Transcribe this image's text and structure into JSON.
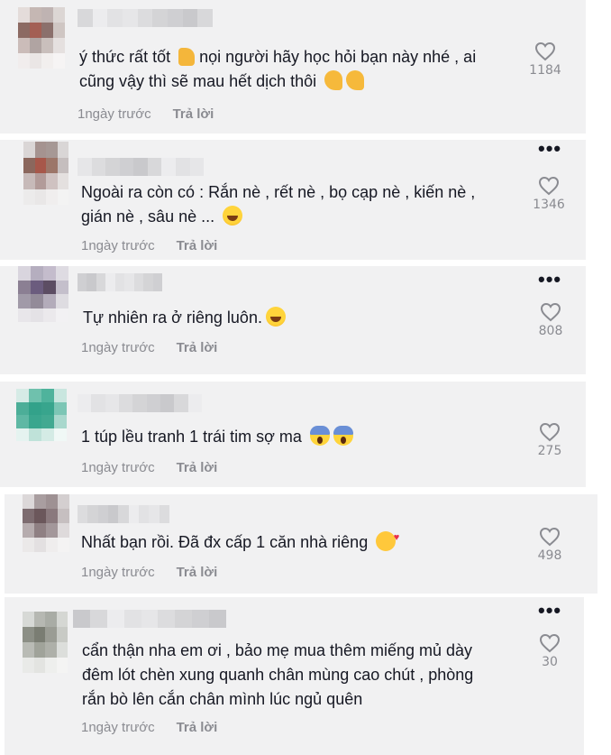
{
  "comments": [
    {
      "text_parts": [
        "ý thức rất tốt",
        "nọi người hãy học hỏi bạn này nhé , ai",
        "cũng vậy thì sẽ mau hết dịch thôi"
      ],
      "emoji": [
        "thumbs-up",
        "flexed-biceps",
        "flexed-biceps"
      ],
      "time": "1ngày trước",
      "reply": "Trả lời",
      "likes": "1184",
      "avatar_colors": [
        "#e4dcda",
        "#c5b7b3",
        "#bfb3b2",
        "#dcd6d4",
        "#8c6a63",
        "#a35f54",
        "#8b706c",
        "#cfc6c3",
        "#cbbcb9",
        "#b0a4a2",
        "#c9bfbc",
        "#e5e0df",
        "#f1eded",
        "#eae6e5",
        "#f2efee",
        "#f6f4f4"
      ]
    },
    {
      "text_parts": [
        "Ngoài ra còn có : Rắn nè , rết nè , bọ cạp nè , kiến nè ,",
        "gián nè , sâu nè ..."
      ],
      "emoji": [
        "grinning-squinting"
      ],
      "time": "1ngày trước",
      "reply": "Trả lời",
      "likes": "1346",
      "avatar_colors": [
        "#dad6d6",
        "#a59390",
        "#a69895",
        "#d9d6d6",
        "#8b675d",
        "#a7574a",
        "#9c7669",
        "#c5bebe",
        "#c7bab9",
        "#b29b99",
        "#cfc2c1",
        "#e4e0df",
        "#ecebeb",
        "#e9e7e7",
        "#f0eeee",
        "#f3f3f3"
      ]
    },
    {
      "text_parts": [
        "Tự nhiên ra ở riêng luôn."
      ],
      "emoji": [
        "grinning-squinting"
      ],
      "time": "1ngày trước",
      "reply": "Trả lời",
      "likes": "808",
      "avatar_colors": [
        "#d9d5de",
        "#b5aebf",
        "#c4bccc",
        "#dedbe2",
        "#8b7f93",
        "#6b5c7e",
        "#5c4d63",
        "#c4bfcb",
        "#a19aa8",
        "#938b99",
        "#b3acba",
        "#dedce1",
        "#e8e6ea",
        "#e4e2e6",
        "#ebe9ec",
        "#f2f1f3"
      ]
    },
    {
      "text_parts": [
        "1 túp lều tranh 1 trái tim sợ ma"
      ],
      "emoji": [
        "face-screaming",
        "face-screaming"
      ],
      "time": "1ngày trước",
      "reply": "Trả lời",
      "likes": "275",
      "avatar_colors": [
        "#d6ebe6",
        "#6fc1ad",
        "#4fb39c",
        "#c9e6df",
        "#4cae98",
        "#33a28a",
        "#38a58d",
        "#7cc6b5",
        "#5fb8a4",
        "#3aa68e",
        "#42a991",
        "#a9d8cd",
        "#e5f3f0",
        "#bfe2d9",
        "#d4ebe5",
        "#f0f8f6"
      ]
    },
    {
      "text_parts": [
        "Nhất bạn rồi. Đã đx cấp 1 căn nhà riêng"
      ],
      "emoji": [
        "smiling-hearts"
      ],
      "time": "1ngày trước",
      "reply": "Trả lời",
      "likes": "498",
      "avatar_colors": [
        "#dcd8d9",
        "#a99ea0",
        "#9e9193",
        "#d4cfd0",
        "#7d6c70",
        "#6b575b",
        "#8a797d",
        "#c6bfc0",
        "#b6acae",
        "#8f8083",
        "#a3979a",
        "#dedadb",
        "#ebe9e9",
        "#e3e0e1",
        "#efeded",
        "#f4f3f3"
      ]
    },
    {
      "text_parts": [
        "cẩn thận nha em ơi , bảo mẹ mua thêm miếng mủ dày",
        "đêm lót chèn xung quanh chân mùng cao chút , phòng",
        "rắn bò lên cắn chân mình lúc ngủ quên"
      ],
      "emoji": [],
      "time": "1ngày trước",
      "reply": "Trả lời",
      "likes": "30",
      "avatar_colors": [
        "#d7d9d6",
        "#b6b8b2",
        "#a9aca5",
        "#d5d7d3",
        "#8c8f86",
        "#7a7d73",
        "#9a9c94",
        "#c8cac5",
        "#b9bbb5",
        "#a0a39a",
        "#aeb0a9",
        "#dcdedb",
        "#e9eae8",
        "#e3e4e1",
        "#eeefed",
        "#f4f4f3"
      ]
    }
  ],
  "icons": {
    "like": "heart-outline-icon",
    "more": "more-dots-icon"
  },
  "colors": {
    "card_bg": "#f1f1f2",
    "text": "#161823",
    "muted": "#8a8b91"
  }
}
